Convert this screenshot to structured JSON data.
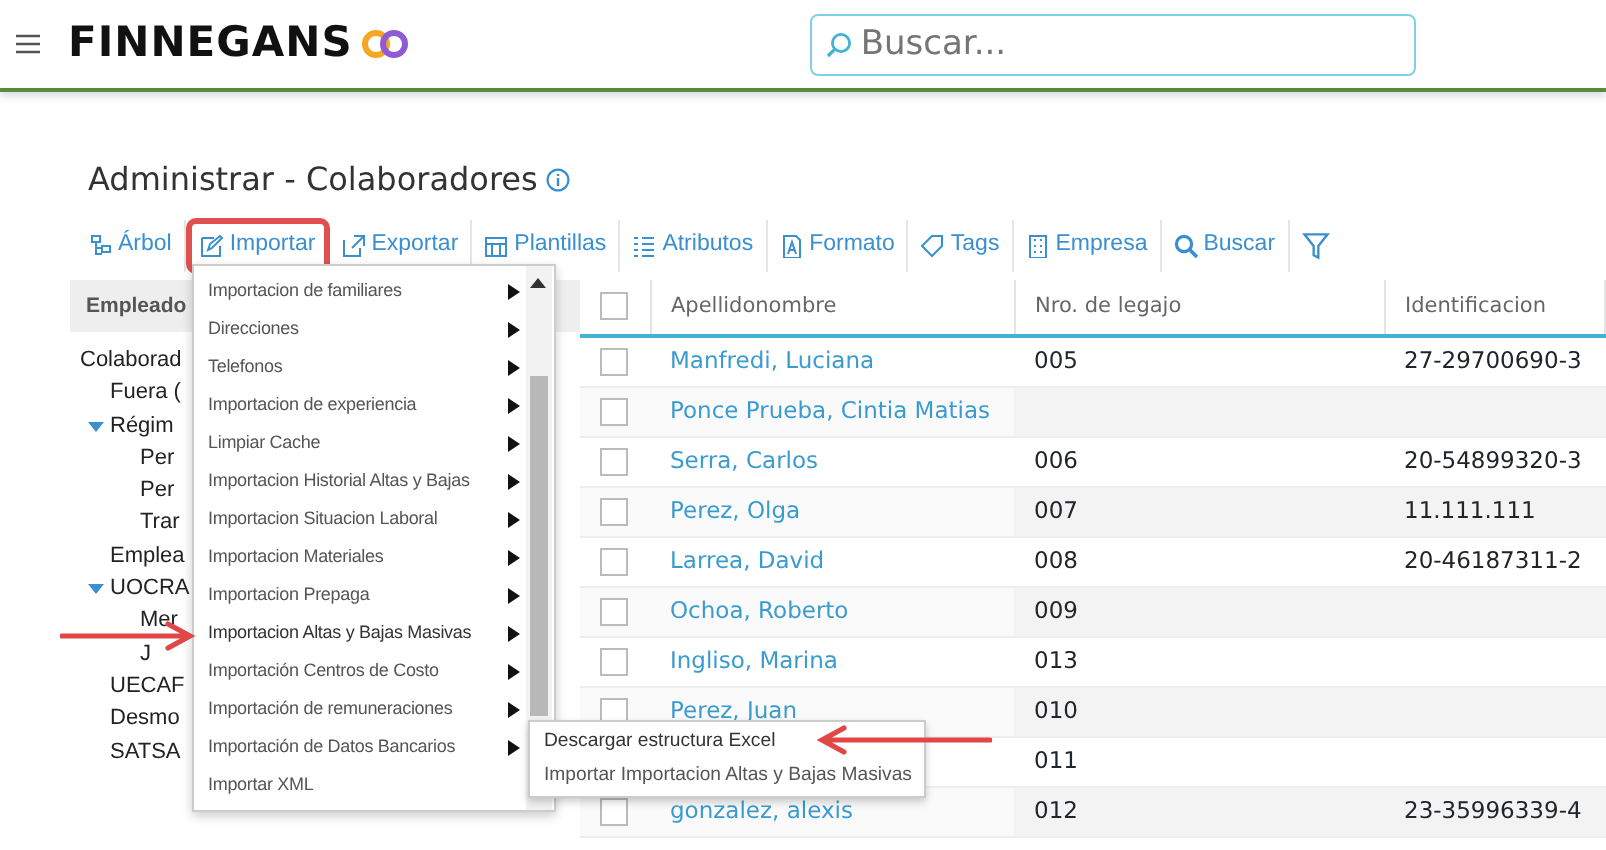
{
  "header": {
    "logo": "FINNEGANS",
    "search": {
      "placeholder": "Buscar..."
    }
  },
  "page_title": "Administrar - Colaboradores",
  "toolbar": [
    {
      "kind": "tree",
      "label": "Árbol",
      "highlighted": false
    },
    {
      "kind": "edit",
      "label": "Importar",
      "highlighted": true
    },
    {
      "kind": "export",
      "label": "Exportar",
      "highlighted": false
    },
    {
      "kind": "grid",
      "label": "Plantillas",
      "highlighted": false
    },
    {
      "kind": "list",
      "label": "Atributos",
      "highlighted": false
    },
    {
      "kind": "file",
      "label": "Formato",
      "highlighted": false
    },
    {
      "kind": "tag",
      "label": "Tags",
      "highlighted": false
    },
    {
      "kind": "building",
      "label": "Empresa",
      "highlighted": false
    },
    {
      "kind": "search",
      "label": "Buscar",
      "highlighted": false
    },
    {
      "kind": "filter"
    }
  ],
  "tree": {
    "header": "Empleado",
    "items": [
      {
        "label": "Colaborad",
        "children": [
          {
            "label": "Fuera ("
          },
          {
            "label": "Régim",
            "expanded": true,
            "children": [
              {
                "label": "Per"
              },
              {
                "label": "Per"
              },
              {
                "label": "Trar"
              }
            ]
          },
          {
            "label": "Emplea"
          },
          {
            "label": "UOCRA",
            "expanded": true,
            "children": [
              {
                "label": "Mer"
              },
              {
                "label": "J"
              }
            ]
          },
          {
            "label": "UECAF"
          },
          {
            "label": "Desmo"
          },
          {
            "label": "SATSA"
          }
        ]
      }
    ]
  },
  "import_menu": {
    "items": [
      {
        "label": "Importacion de familiares",
        "submenu": true,
        "pointed": false
      },
      {
        "label": "Direcciones",
        "submenu": true,
        "pointed": false
      },
      {
        "label": "Telefonos",
        "submenu": true,
        "pointed": false
      },
      {
        "label": "Importacion de experiencia",
        "submenu": true,
        "pointed": false
      },
      {
        "label": "Limpiar Cache",
        "submenu": true,
        "pointed": false
      },
      {
        "label": "Importacion Historial Altas y Bajas",
        "submenu": true,
        "pointed": false
      },
      {
        "label": "Importacion Situacion Laboral",
        "submenu": true,
        "pointed": false
      },
      {
        "label": "Importacion Materiales",
        "submenu": true,
        "pointed": false
      },
      {
        "label": "Importacion Prepaga",
        "submenu": true,
        "pointed": false
      },
      {
        "label": "Importacion Altas y Bajas Masivas",
        "submenu": true,
        "pointed": true
      },
      {
        "label": "Importación Centros de Costo",
        "submenu": true,
        "pointed": false
      },
      {
        "label": "Importación de remuneraciones",
        "submenu": true,
        "pointed": false
      },
      {
        "label": "Importación de Datos Bancarios",
        "submenu": true,
        "pointed": false
      },
      {
        "label": "Importar XML",
        "submenu": false,
        "pointed": false
      }
    ]
  },
  "submenu": {
    "items": [
      {
        "label": "Descargar estructura Excel",
        "pointed": true
      },
      {
        "label": "Importar Importacion Altas y Bajas Masivas",
        "pointed": false
      }
    ]
  },
  "table": {
    "all_selected": false,
    "columns": [
      "Apellidonombre",
      "Nro. de legajo",
      "Identificacion"
    ],
    "rows": [
      {
        "selected": false,
        "name": "Manfredi, Luciana",
        "legajo": "005",
        "identificacion": "27-29700690-3"
      },
      {
        "selected": false,
        "name": "Ponce Prueba, Cintia Matias"
      },
      {
        "selected": false,
        "name": "Serra, Carlos",
        "legajo": "006",
        "identificacion": "20-54899320-3"
      },
      {
        "selected": false,
        "name": "Perez, Olga",
        "legajo": "007",
        "identificacion": "11.111.111"
      },
      {
        "selected": false,
        "name": "Larrea, David",
        "legajo": "008",
        "identificacion": "20-46187311-2"
      },
      {
        "selected": false,
        "name": "Ochoa, Roberto",
        "legajo": "009"
      },
      {
        "selected": false,
        "name": "Ingliso, Marina",
        "legajo": "013"
      },
      {
        "selected": false,
        "name": "Perez, Juan",
        "legajo": "010"
      },
      {
        "legajo": "011"
      },
      {
        "selected": false,
        "name": "gonzalez, alexis",
        "legajo": "012",
        "identificacion": "23-35996339-4"
      }
    ]
  }
}
